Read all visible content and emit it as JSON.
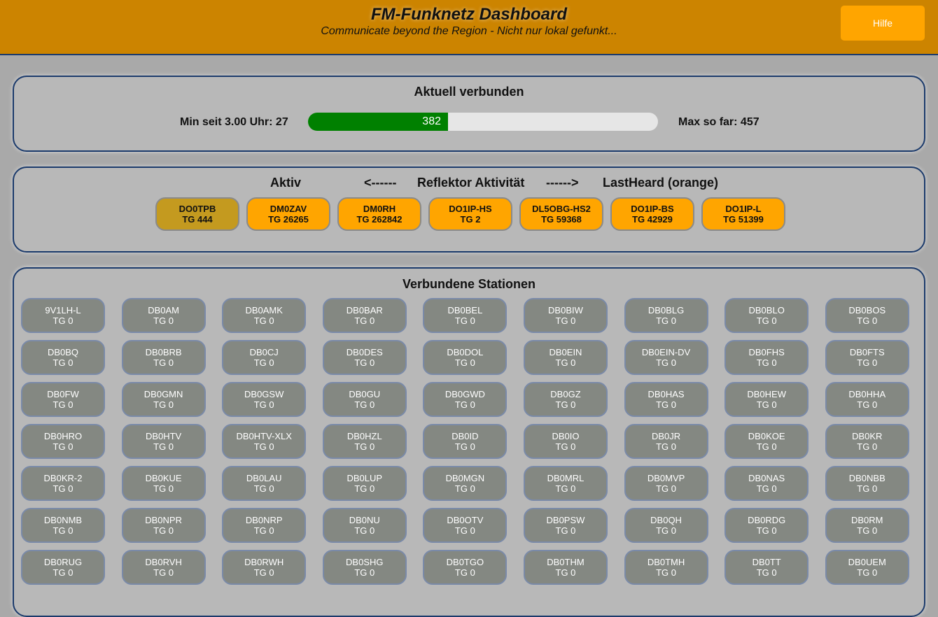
{
  "header": {
    "title": "FM-Funknetz Dashboard",
    "subtitle": "Communicate beyond the Region - Nicht nur lokal gefunkt...",
    "help_label": "Hilfe"
  },
  "connected": {
    "title": "Aktuell verbunden",
    "min_label": "Min seit 3.00 Uhr: 27",
    "max_label": "Max so far: 457",
    "current": "382",
    "current_fraction": 0.4,
    "bar_color": "#008000"
  },
  "activity": {
    "left_label": "Aktiv",
    "arrow_left": "<------",
    "center_label": "Reflektor Aktivität",
    "arrow_right": "------>",
    "right_label": "LastHeard (orange)",
    "active_color": "#c49a1f",
    "lastheard_color": "#ffa500",
    "chips": [
      {
        "call": "DO0TPB",
        "tg": "TG 444",
        "active": true
      },
      {
        "call": "DM0ZAV",
        "tg": "TG 26265",
        "active": false
      },
      {
        "call": "DM0RH",
        "tg": "TG 262842",
        "active": false
      },
      {
        "call": "DO1IP-HS",
        "tg": "TG 2",
        "active": false
      },
      {
        "call": "DL5OBG-HS2",
        "tg": "TG 59368",
        "active": false
      },
      {
        "call": "DO1IP-BS",
        "tg": "TG 42929",
        "active": false
      },
      {
        "call": "DO1IP-L",
        "tg": "TG 51399",
        "active": false
      }
    ]
  },
  "stations": {
    "title": "Verbundene Stationen",
    "items": [
      {
        "call": "9V1LH-L",
        "tg": "TG 0"
      },
      {
        "call": "DB0AM",
        "tg": "TG 0"
      },
      {
        "call": "DB0AMK",
        "tg": "TG 0"
      },
      {
        "call": "DB0BAR",
        "tg": "TG 0"
      },
      {
        "call": "DB0BEL",
        "tg": "TG 0"
      },
      {
        "call": "DB0BIW",
        "tg": "TG 0"
      },
      {
        "call": "DB0BLG",
        "tg": "TG 0"
      },
      {
        "call": "DB0BLO",
        "tg": "TG 0"
      },
      {
        "call": "DB0BOS",
        "tg": "TG 0"
      },
      {
        "call": "DB0BQ",
        "tg": "TG 0"
      },
      {
        "call": "DB0BRB",
        "tg": "TG 0"
      },
      {
        "call": "DB0CJ",
        "tg": "TG 0"
      },
      {
        "call": "DB0DES",
        "tg": "TG 0"
      },
      {
        "call": "DB0DOL",
        "tg": "TG 0"
      },
      {
        "call": "DB0EIN",
        "tg": "TG 0"
      },
      {
        "call": "DB0EIN-DV",
        "tg": "TG 0"
      },
      {
        "call": "DB0FHS",
        "tg": "TG 0"
      },
      {
        "call": "DB0FTS",
        "tg": "TG 0"
      },
      {
        "call": "DB0FW",
        "tg": "TG 0"
      },
      {
        "call": "DB0GMN",
        "tg": "TG 0"
      },
      {
        "call": "DB0GSW",
        "tg": "TG 0"
      },
      {
        "call": "DB0GU",
        "tg": "TG 0"
      },
      {
        "call": "DB0GWD",
        "tg": "TG 0"
      },
      {
        "call": "DB0GZ",
        "tg": "TG 0"
      },
      {
        "call": "DB0HAS",
        "tg": "TG 0"
      },
      {
        "call": "DB0HEW",
        "tg": "TG 0"
      },
      {
        "call": "DB0HHA",
        "tg": "TG 0"
      },
      {
        "call": "DB0HRO",
        "tg": "TG 0"
      },
      {
        "call": "DB0HTV",
        "tg": "TG 0"
      },
      {
        "call": "DB0HTV-XLX",
        "tg": "TG 0"
      },
      {
        "call": "DB0HZL",
        "tg": "TG 0"
      },
      {
        "call": "DB0ID",
        "tg": "TG 0"
      },
      {
        "call": "DB0IO",
        "tg": "TG 0"
      },
      {
        "call": "DB0JR",
        "tg": "TG 0"
      },
      {
        "call": "DB0KOE",
        "tg": "TG 0"
      },
      {
        "call": "DB0KR",
        "tg": "TG 0"
      },
      {
        "call": "DB0KR-2",
        "tg": "TG 0"
      },
      {
        "call": "DB0KUE",
        "tg": "TG 0"
      },
      {
        "call": "DB0LAU",
        "tg": "TG 0"
      },
      {
        "call": "DB0LUP",
        "tg": "TG 0"
      },
      {
        "call": "DB0MGN",
        "tg": "TG 0"
      },
      {
        "call": "DB0MRL",
        "tg": "TG 0"
      },
      {
        "call": "DB0MVP",
        "tg": "TG 0"
      },
      {
        "call": "DB0NAS",
        "tg": "TG 0"
      },
      {
        "call": "DB0NBB",
        "tg": "TG 0"
      },
      {
        "call": "DB0NMB",
        "tg": "TG 0"
      },
      {
        "call": "DB0NPR",
        "tg": "TG 0"
      },
      {
        "call": "DB0NRP",
        "tg": "TG 0"
      },
      {
        "call": "DB0NU",
        "tg": "TG 0"
      },
      {
        "call": "DB0OTV",
        "tg": "TG 0"
      },
      {
        "call": "DB0PSW",
        "tg": "TG 0"
      },
      {
        "call": "DB0QH",
        "tg": "TG 0"
      },
      {
        "call": "DB0RDG",
        "tg": "TG 0"
      },
      {
        "call": "DB0RM",
        "tg": "TG 0"
      },
      {
        "call": "DB0RUG",
        "tg": "TG 0"
      },
      {
        "call": "DB0RVH",
        "tg": "TG 0"
      },
      {
        "call": "DB0RWH",
        "tg": "TG 0"
      },
      {
        "call": "DB0SHG",
        "tg": "TG 0"
      },
      {
        "call": "DB0TGO",
        "tg": "TG 0"
      },
      {
        "call": "DB0THM",
        "tg": "TG 0"
      },
      {
        "call": "DB0TMH",
        "tg": "TG 0"
      },
      {
        "call": "DB0TT",
        "tg": "TG 0"
      },
      {
        "call": "DB0UEM",
        "tg": "TG 0"
      }
    ]
  }
}
